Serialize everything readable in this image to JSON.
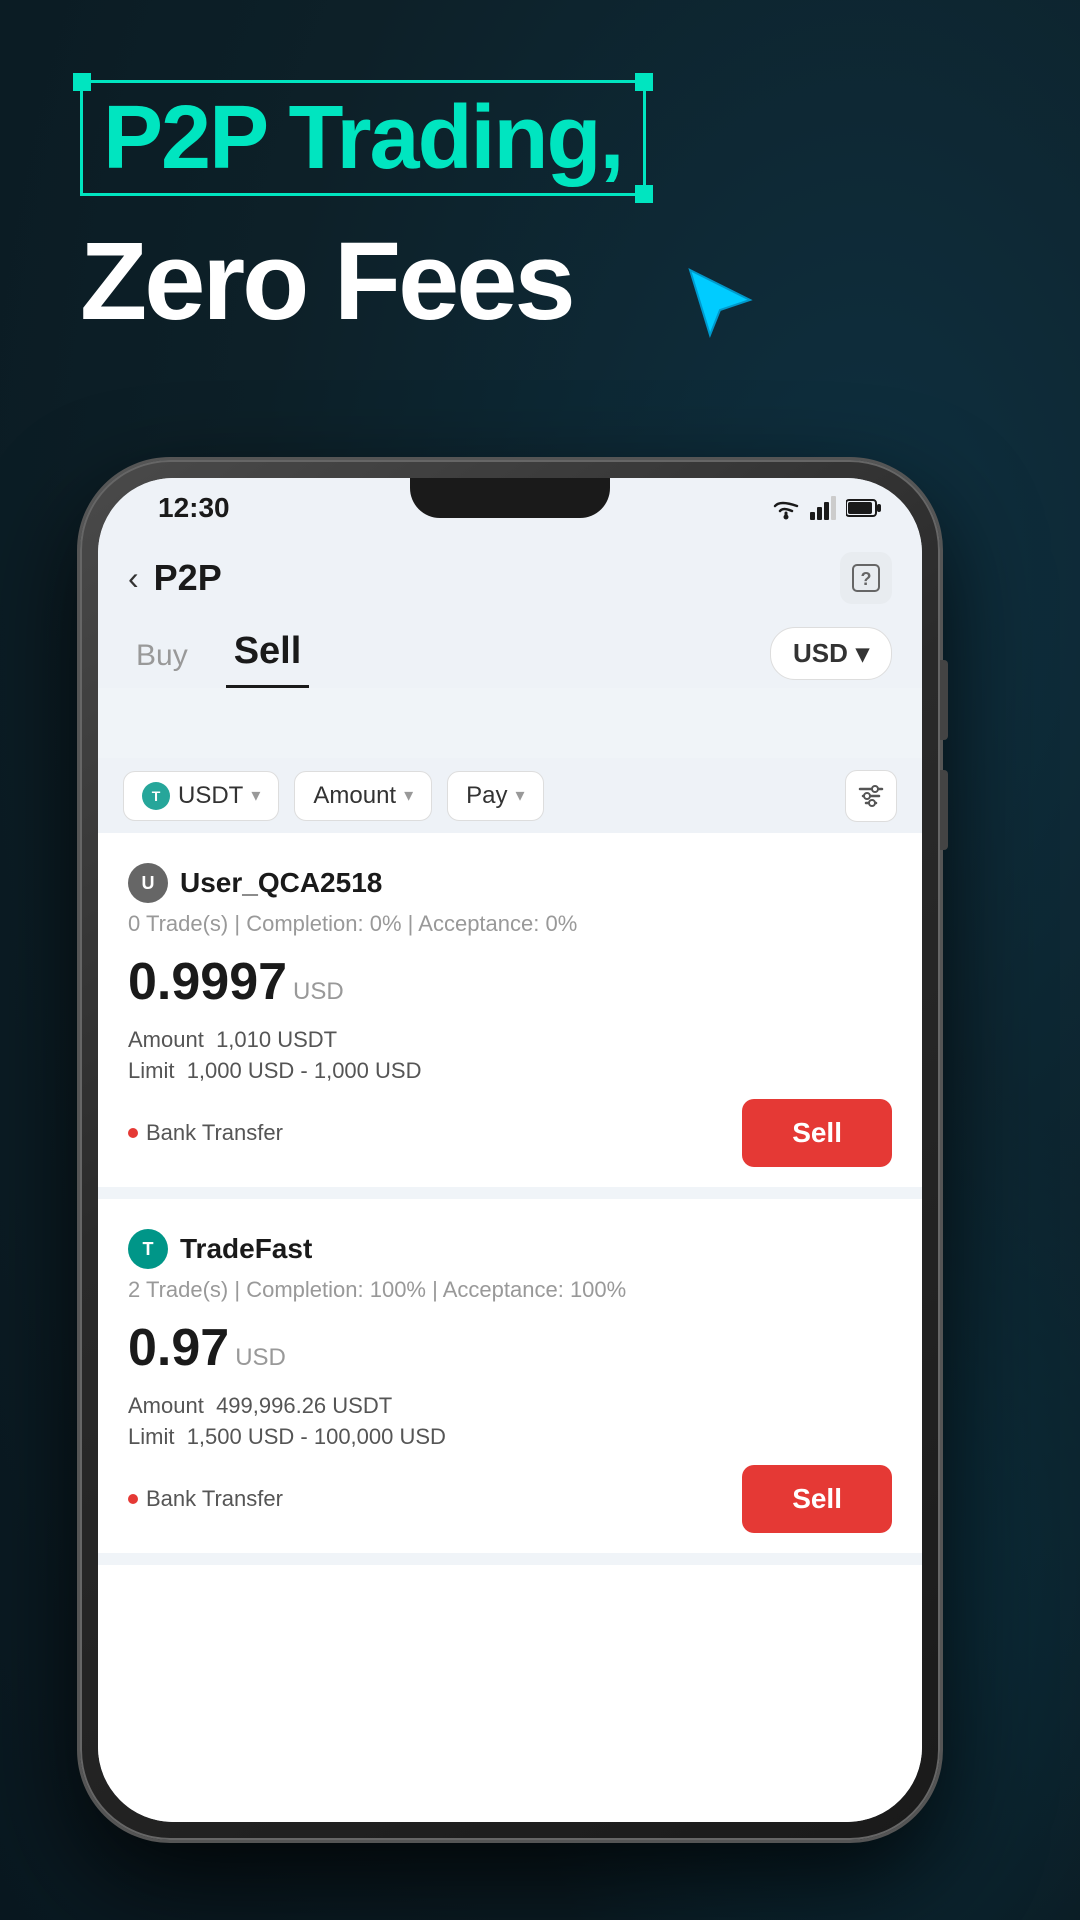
{
  "background": {
    "color": "#0d2028"
  },
  "header": {
    "headline1": "P2P Trading,",
    "headline2": "Zero Fees"
  },
  "status_bar": {
    "time": "12:30"
  },
  "app_bar": {
    "back_label": "‹",
    "title": "P2P",
    "help_icon": "?"
  },
  "tabs": {
    "buy_label": "Buy",
    "sell_label": "Sell",
    "active": "sell"
  },
  "currency_selector": {
    "value": "USD",
    "icon": "chevron-down"
  },
  "filters": {
    "crypto": {
      "label": "USDT",
      "icon": "T"
    },
    "amount": {
      "label": "Amount"
    },
    "pay": {
      "label": "Pay"
    }
  },
  "listings": [
    {
      "username": "User_QCA2518",
      "avatar_letter": "U",
      "avatar_color": "#666",
      "trades": "0 Trade(s)",
      "completion": "Completion: 0%",
      "acceptance": "Acceptance: 0%",
      "price": "0.9997",
      "price_currency": "USD",
      "amount_label": "Amount",
      "amount_value": "1,010 USDT",
      "limit_label": "Limit",
      "limit_value": "1,000 USD - 1,000 USD",
      "payment_method": "Bank Transfer",
      "action": "Sell"
    },
    {
      "username": "TradeFast",
      "avatar_letter": "T",
      "avatar_color": "#009688",
      "trades": "2 Trade(s)",
      "completion": "Completion: 100%",
      "acceptance": "Acceptance: 100%",
      "price": "0.97",
      "price_currency": "USD",
      "amount_label": "Amount",
      "amount_value": "499,996.26 USDT",
      "limit_label": "Limit",
      "limit_value": "1,500 USD - 100,000 USD",
      "payment_method": "Bank Transfer",
      "action": "Sell"
    }
  ],
  "colors": {
    "accent": "#00e5c0",
    "sell_btn": "#e53935",
    "background_dark": "#0d2028"
  }
}
